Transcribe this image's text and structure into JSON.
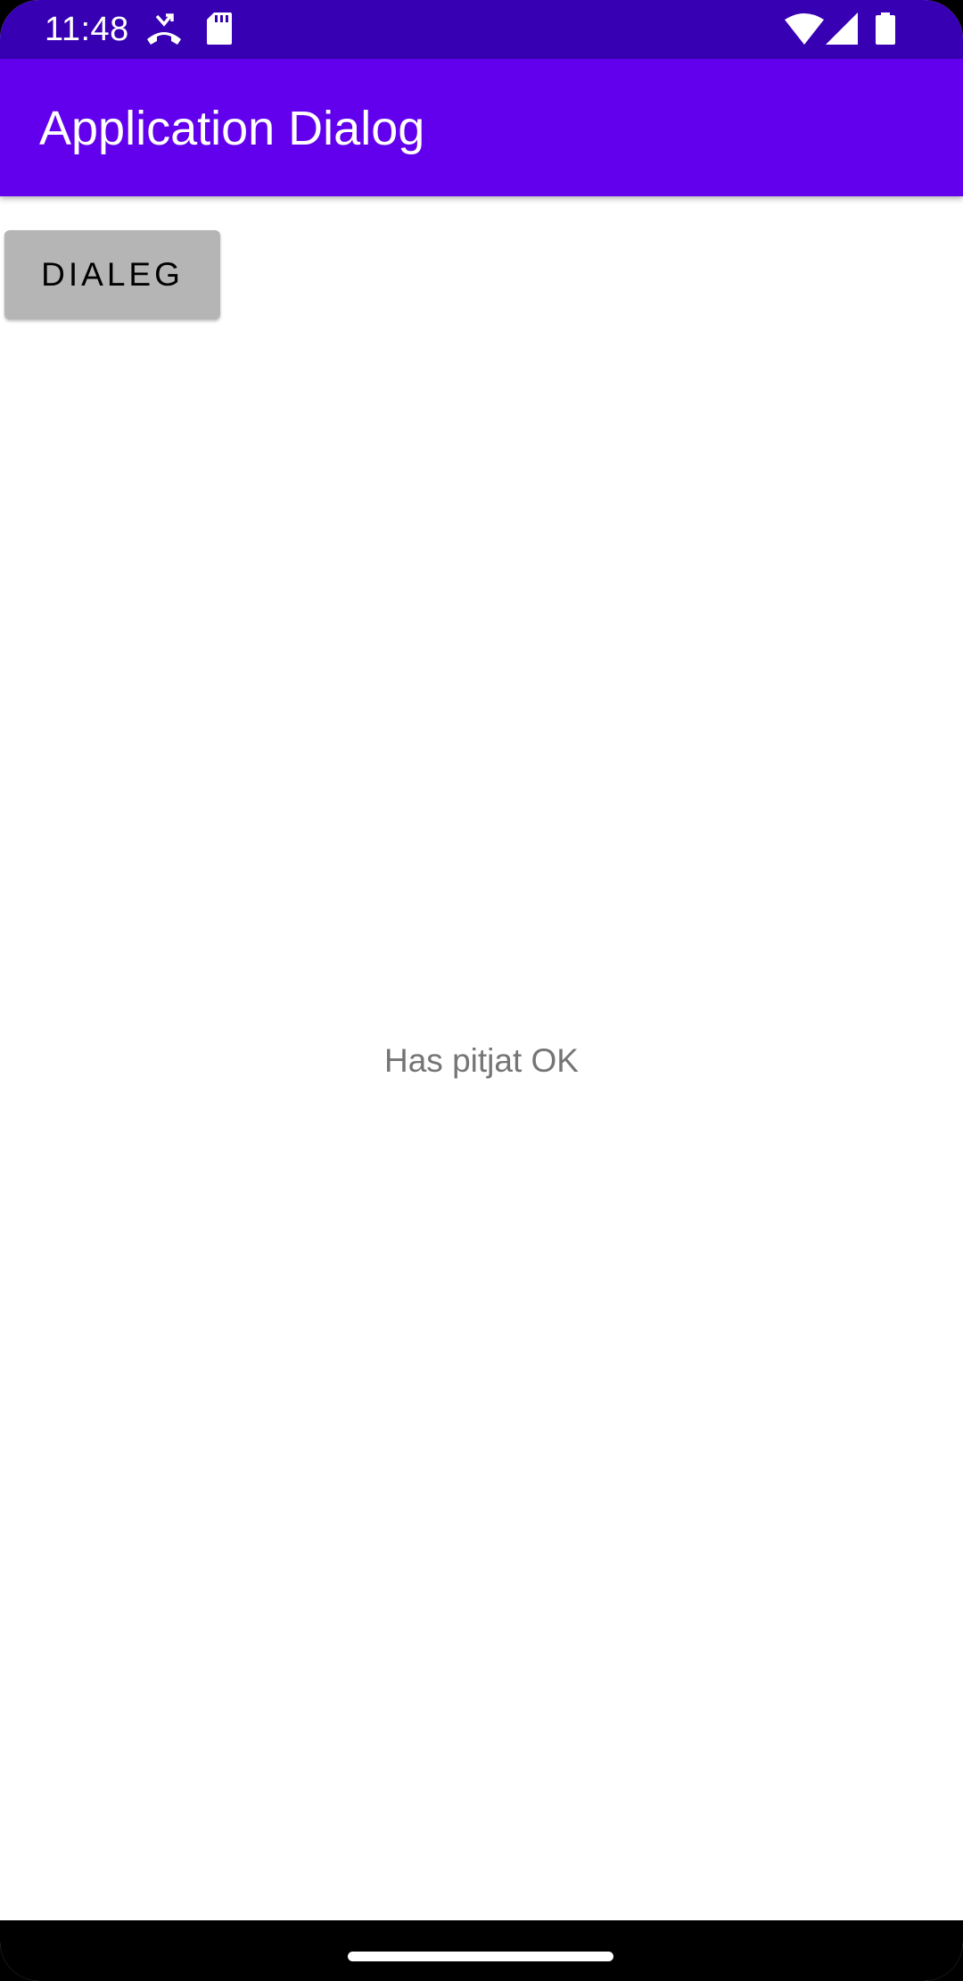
{
  "status_bar": {
    "time": "11:48",
    "icons": [
      "missed-call-icon",
      "sd-card-icon",
      "wifi-icon",
      "signal-icon",
      "battery-icon"
    ],
    "background": "#3700b3"
  },
  "app_bar": {
    "title": "Application Dialog",
    "background": "#6200ee"
  },
  "main": {
    "dialog_button_label": "DIALEG",
    "result_text": "Has pitjat OK"
  },
  "colors": {
    "button_background": "#b5b5b5",
    "result_text": "#757575"
  }
}
